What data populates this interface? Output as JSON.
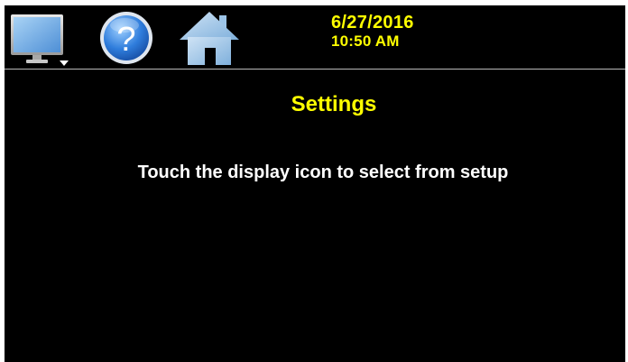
{
  "header": {
    "date": "6/27/2016",
    "time": "10:50 AM",
    "icons": [
      "display-menu-icon",
      "help-icon",
      "home-icon"
    ]
  },
  "main": {
    "title": "Settings",
    "instructions": "Touch the display icon to select from setup"
  },
  "colors": {
    "background": "#000000",
    "accent_text": "#ffff00",
    "body_text": "#ffffff",
    "frame": "#ffffff",
    "divider": "#b9b9b9"
  }
}
